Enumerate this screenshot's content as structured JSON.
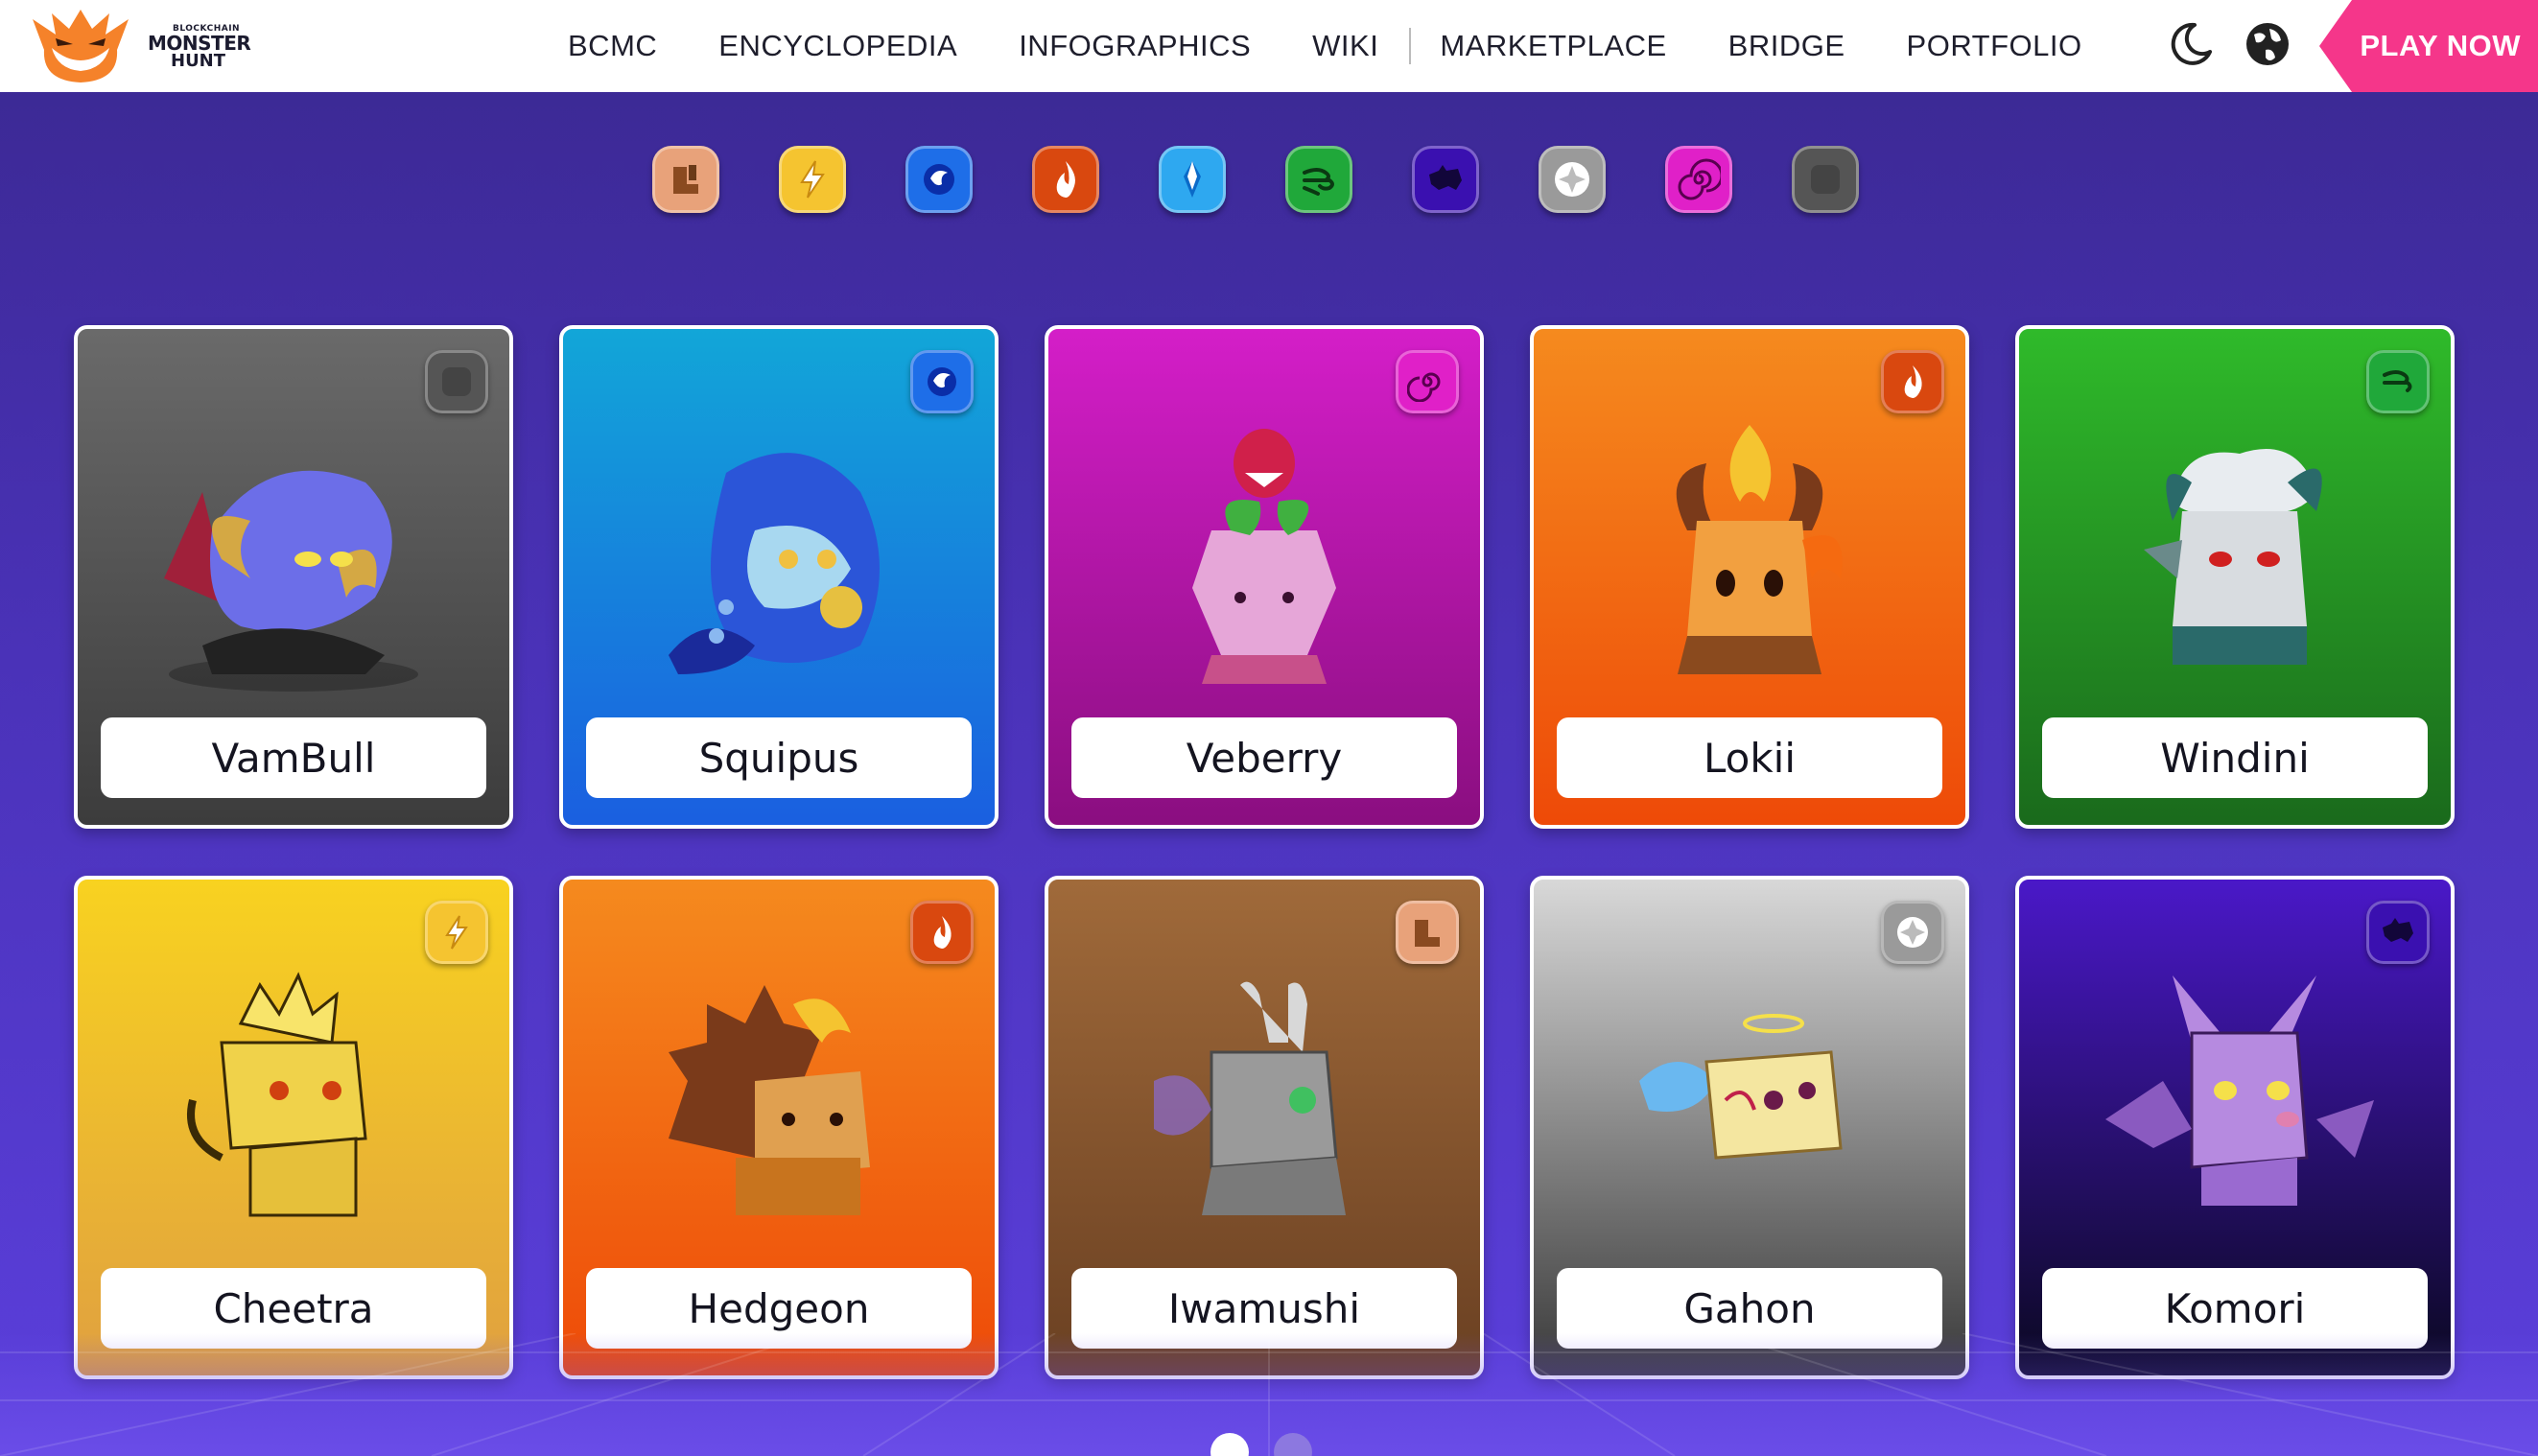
{
  "header": {
    "logo": {
      "small": "BLOCKCHAIN",
      "line1": "MONSTER",
      "line2": "HUNT"
    },
    "nav": [
      {
        "label": "BCMC"
      },
      {
        "label": "ENCYCLOPEDIA"
      },
      {
        "label": "INFOGRAPHICS"
      },
      {
        "label": "WIKI"
      },
      {
        "label": "MARKETPLACE"
      },
      {
        "label": "BRIDGE"
      },
      {
        "label": "PORTFOLIO"
      }
    ],
    "theme_icon": "moon-icon",
    "language_icon": "globe-icon",
    "play_label": "PLAY NOW",
    "play_color": "#f5368a"
  },
  "filters": [
    {
      "name": "earth",
      "icon": "boots-icon",
      "color": "#e8a27a"
    },
    {
      "name": "electric",
      "icon": "lightning-icon",
      "color": "#f5c430"
    },
    {
      "name": "water",
      "icon": "water-icon",
      "color": "#1e6ee8"
    },
    {
      "name": "fire",
      "icon": "fire-icon",
      "color": "#d9480f"
    },
    {
      "name": "ice",
      "icon": "crystal-icon",
      "color": "#2ea8f0"
    },
    {
      "name": "wind",
      "icon": "wind-icon",
      "color": "#20a83a"
    },
    {
      "name": "dark",
      "icon": "bat-icon",
      "color": "#3a10b0"
    },
    {
      "name": "light",
      "icon": "sun-icon",
      "color": "#9a9a9a"
    },
    {
      "name": "psychic",
      "icon": "spiral-icon",
      "color": "#e020c8"
    },
    {
      "name": "normal",
      "icon": "blank-icon",
      "color": "#555555"
    }
  ],
  "cards": [
    {
      "name": "VamBull",
      "element": "normal",
      "bg_top": "#6a6a6a",
      "bg_bottom": "#3c3c3c",
      "body": "#6c6ee8"
    },
    {
      "name": "Squipus",
      "element": "water",
      "bg_top": "#12a6d8",
      "bg_bottom": "#1a5fe0",
      "body": "#2b55d8"
    },
    {
      "name": "Veberry",
      "element": "psychic",
      "bg_top": "#d41ec8",
      "bg_bottom": "#8a0e80",
      "body": "#e6a6d8"
    },
    {
      "name": "Lokii",
      "element": "fire",
      "bg_top": "#f58a1e",
      "bg_bottom": "#ee4a08",
      "body": "#f2a040"
    },
    {
      "name": "Windini",
      "element": "wind",
      "bg_top": "#2fba2a",
      "bg_bottom": "#1a6a1c",
      "body": "#d8dce0"
    },
    {
      "name": "Cheetra",
      "element": "electric",
      "bg_top": "#f8d220",
      "bg_bottom": "#e0a040",
      "body": "#f0d24a"
    },
    {
      "name": "Hedgeon",
      "element": "fire",
      "bg_top": "#f58a1e",
      "bg_bottom": "#ee4a08",
      "body": "#c8741e"
    },
    {
      "name": "Iwamushi",
      "element": "earth",
      "bg_top": "#a06a3a",
      "bg_bottom": "#6a4022",
      "body": "#9a9a9a"
    },
    {
      "name": "Gahon",
      "element": "light",
      "bg_top": "#d8d8d8",
      "bg_bottom": "#3a3a3a",
      "body": "#f4e6a0"
    },
    {
      "name": "Komori",
      "element": "dark",
      "bg_top": "#4a18c8",
      "bg_bottom": "#0a0820",
      "body": "#b68ae0"
    }
  ],
  "pagination": {
    "pages": 2,
    "current": 1
  }
}
